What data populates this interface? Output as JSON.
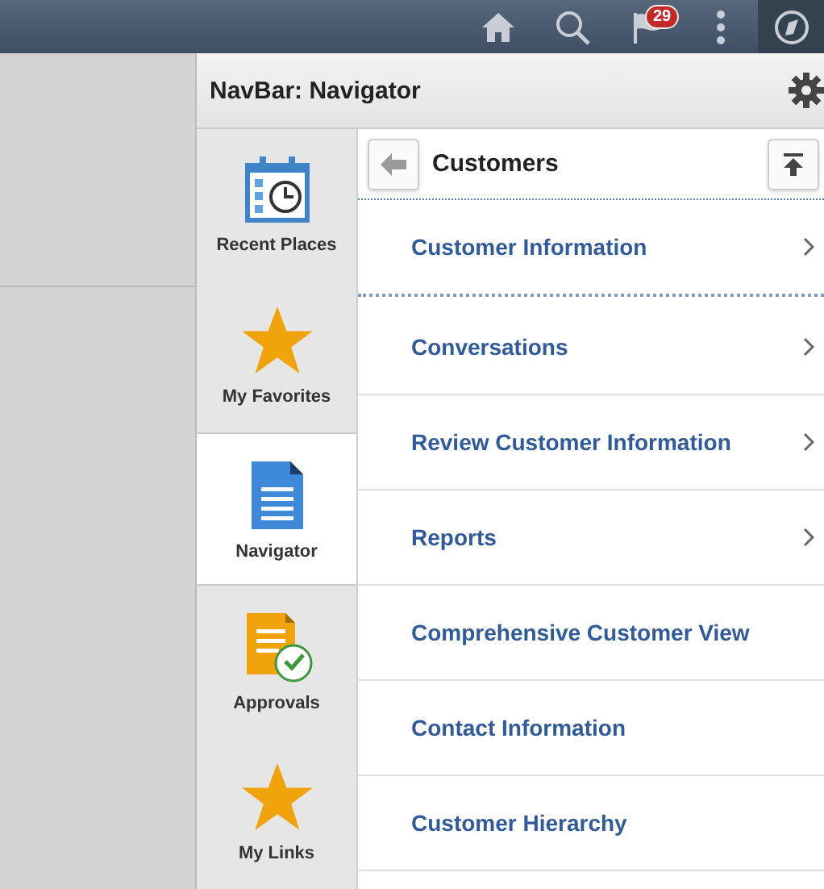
{
  "top_bar": {
    "notification_count": "29"
  },
  "panel": {
    "title": "NavBar: Navigator"
  },
  "sidebar": {
    "items": [
      {
        "label": "Recent Places",
        "kind": "calendar",
        "selected": false
      },
      {
        "label": "My Favorites",
        "kind": "star",
        "selected": false
      },
      {
        "label": "Navigator",
        "kind": "document",
        "selected": true
      },
      {
        "label": "Approvals",
        "kind": "approval",
        "selected": false
      },
      {
        "label": "My Links",
        "kind": "star",
        "selected": false
      }
    ]
  },
  "navigator": {
    "title": "Customers",
    "items": [
      {
        "label": "Customer Information",
        "has_children": true,
        "selected": true
      },
      {
        "label": "Conversations",
        "has_children": true,
        "selected": false
      },
      {
        "label": "Review Customer Information",
        "has_children": true,
        "selected": false
      },
      {
        "label": "Reports",
        "has_children": true,
        "selected": false
      },
      {
        "label": "Comprehensive Customer View",
        "has_children": false,
        "selected": false
      },
      {
        "label": "Contact Information",
        "has_children": false,
        "selected": false
      },
      {
        "label": "Customer Hierarchy",
        "has_children": false,
        "selected": false
      }
    ]
  }
}
